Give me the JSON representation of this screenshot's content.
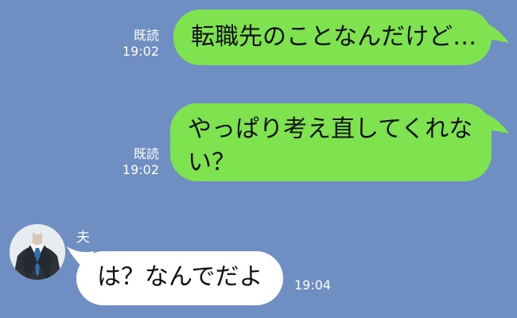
{
  "conversation": {
    "messages": [
      {
        "direction": "outgoing",
        "text": "転職先のことなんだけど…",
        "read_label": "既読",
        "time": "19:02"
      },
      {
        "direction": "outgoing",
        "text_line1": "やっぱり考え直してくれな",
        "text_line2": "い？",
        "read_label": "既読",
        "time": "19:02"
      },
      {
        "direction": "incoming",
        "sender": "夫",
        "text": "は？なんでだよ",
        "time": "19:04"
      }
    ]
  },
  "colors": {
    "background": "#6f8fc3",
    "outgoing_bubble": "#7fe34f",
    "incoming_bubble": "#ffffff"
  },
  "icons": {
    "avatar": "husband-avatar-icon"
  }
}
